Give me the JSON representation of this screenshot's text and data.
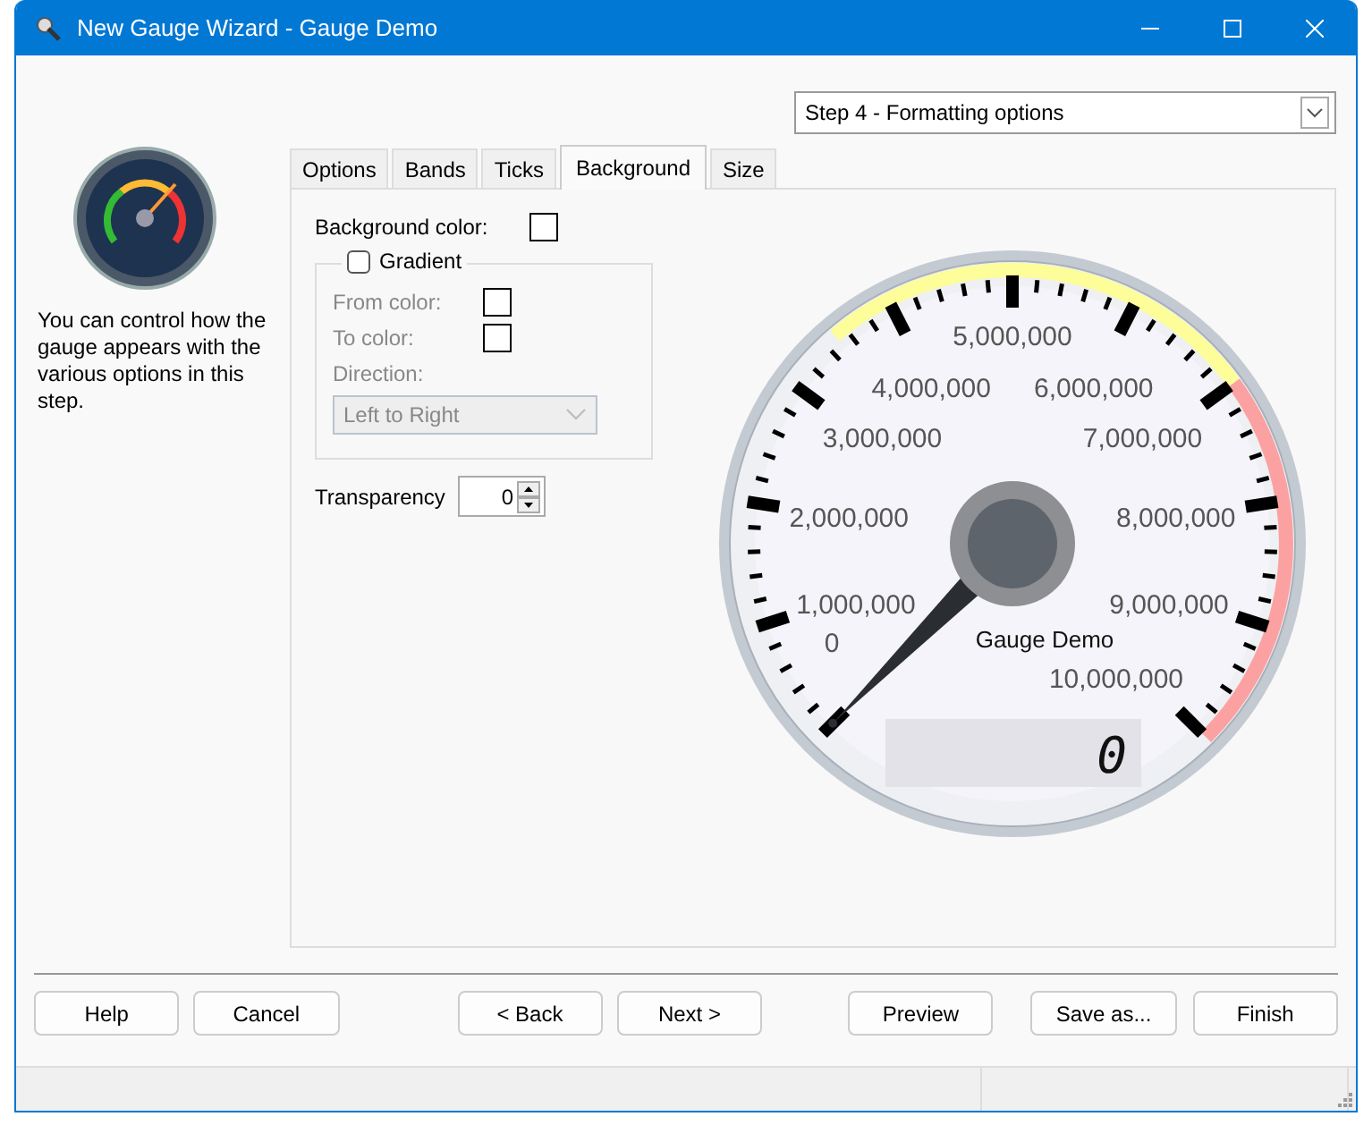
{
  "window": {
    "title": "New Gauge Wizard - Gauge Demo"
  },
  "step_dropdown": {
    "value": "Step 4 - Formatting options"
  },
  "description": "You can control how the gauge appears with the various options in this step.",
  "tabs": [
    {
      "label": "Options",
      "selected": false
    },
    {
      "label": "Bands",
      "selected": false
    },
    {
      "label": "Ticks",
      "selected": false
    },
    {
      "label": "Background",
      "selected": true
    },
    {
      "label": "Size",
      "selected": false
    }
  ],
  "background_color": {
    "label": "Background color:"
  },
  "gradient": {
    "label": "Gradient",
    "checked": false,
    "from_label": "From color:",
    "to_label": "To color:",
    "direction_label": "Direction:",
    "direction_value": "Left to Right"
  },
  "transparency": {
    "label": "Transparency",
    "value": "0"
  },
  "gauge": {
    "scale_labels": [
      "5,000,000",
      "4,000,000",
      "6,000,000",
      "3,000,000",
      "7,000,000",
      "2,000,000",
      "8,000,000",
      "1,000,000",
      "9,000,000",
      "0",
      "10,000,000"
    ],
    "caption": "Gauge Demo",
    "readout": "0",
    "level": 0
  },
  "buttons": [
    "Help",
    "Cancel",
    "< Back",
    "Next >",
    "Preview",
    "Save as...",
    "Finish"
  ]
}
